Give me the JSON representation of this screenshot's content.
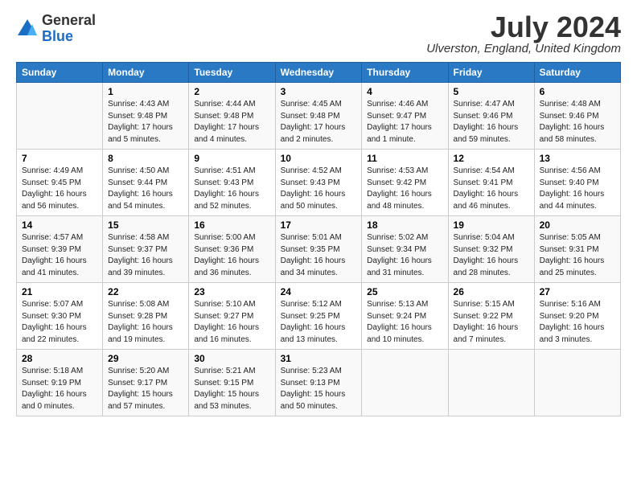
{
  "logo": {
    "general": "General",
    "blue": "Blue"
  },
  "title": "July 2024",
  "location": "Ulverston, England, United Kingdom",
  "days_of_week": [
    "Sunday",
    "Monday",
    "Tuesday",
    "Wednesday",
    "Thursday",
    "Friday",
    "Saturday"
  ],
  "weeks": [
    [
      {
        "day": "",
        "sunrise": "",
        "sunset": "",
        "daylight": ""
      },
      {
        "day": "1",
        "sunrise": "Sunrise: 4:43 AM",
        "sunset": "Sunset: 9:48 PM",
        "daylight": "Daylight: 17 hours and 5 minutes."
      },
      {
        "day": "2",
        "sunrise": "Sunrise: 4:44 AM",
        "sunset": "Sunset: 9:48 PM",
        "daylight": "Daylight: 17 hours and 4 minutes."
      },
      {
        "day": "3",
        "sunrise": "Sunrise: 4:45 AM",
        "sunset": "Sunset: 9:48 PM",
        "daylight": "Daylight: 17 hours and 2 minutes."
      },
      {
        "day": "4",
        "sunrise": "Sunrise: 4:46 AM",
        "sunset": "Sunset: 9:47 PM",
        "daylight": "Daylight: 17 hours and 1 minute."
      },
      {
        "day": "5",
        "sunrise": "Sunrise: 4:47 AM",
        "sunset": "Sunset: 9:46 PM",
        "daylight": "Daylight: 16 hours and 59 minutes."
      },
      {
        "day": "6",
        "sunrise": "Sunrise: 4:48 AM",
        "sunset": "Sunset: 9:46 PM",
        "daylight": "Daylight: 16 hours and 58 minutes."
      }
    ],
    [
      {
        "day": "7",
        "sunrise": "Sunrise: 4:49 AM",
        "sunset": "Sunset: 9:45 PM",
        "daylight": "Daylight: 16 hours and 56 minutes."
      },
      {
        "day": "8",
        "sunrise": "Sunrise: 4:50 AM",
        "sunset": "Sunset: 9:44 PM",
        "daylight": "Daylight: 16 hours and 54 minutes."
      },
      {
        "day": "9",
        "sunrise": "Sunrise: 4:51 AM",
        "sunset": "Sunset: 9:43 PM",
        "daylight": "Daylight: 16 hours and 52 minutes."
      },
      {
        "day": "10",
        "sunrise": "Sunrise: 4:52 AM",
        "sunset": "Sunset: 9:43 PM",
        "daylight": "Daylight: 16 hours and 50 minutes."
      },
      {
        "day": "11",
        "sunrise": "Sunrise: 4:53 AM",
        "sunset": "Sunset: 9:42 PM",
        "daylight": "Daylight: 16 hours and 48 minutes."
      },
      {
        "day": "12",
        "sunrise": "Sunrise: 4:54 AM",
        "sunset": "Sunset: 9:41 PM",
        "daylight": "Daylight: 16 hours and 46 minutes."
      },
      {
        "day": "13",
        "sunrise": "Sunrise: 4:56 AM",
        "sunset": "Sunset: 9:40 PM",
        "daylight": "Daylight: 16 hours and 44 minutes."
      }
    ],
    [
      {
        "day": "14",
        "sunrise": "Sunrise: 4:57 AM",
        "sunset": "Sunset: 9:39 PM",
        "daylight": "Daylight: 16 hours and 41 minutes."
      },
      {
        "day": "15",
        "sunrise": "Sunrise: 4:58 AM",
        "sunset": "Sunset: 9:37 PM",
        "daylight": "Daylight: 16 hours and 39 minutes."
      },
      {
        "day": "16",
        "sunrise": "Sunrise: 5:00 AM",
        "sunset": "Sunset: 9:36 PM",
        "daylight": "Daylight: 16 hours and 36 minutes."
      },
      {
        "day": "17",
        "sunrise": "Sunrise: 5:01 AM",
        "sunset": "Sunset: 9:35 PM",
        "daylight": "Daylight: 16 hours and 34 minutes."
      },
      {
        "day": "18",
        "sunrise": "Sunrise: 5:02 AM",
        "sunset": "Sunset: 9:34 PM",
        "daylight": "Daylight: 16 hours and 31 minutes."
      },
      {
        "day": "19",
        "sunrise": "Sunrise: 5:04 AM",
        "sunset": "Sunset: 9:32 PM",
        "daylight": "Daylight: 16 hours and 28 minutes."
      },
      {
        "day": "20",
        "sunrise": "Sunrise: 5:05 AM",
        "sunset": "Sunset: 9:31 PM",
        "daylight": "Daylight: 16 hours and 25 minutes."
      }
    ],
    [
      {
        "day": "21",
        "sunrise": "Sunrise: 5:07 AM",
        "sunset": "Sunset: 9:30 PM",
        "daylight": "Daylight: 16 hours and 22 minutes."
      },
      {
        "day": "22",
        "sunrise": "Sunrise: 5:08 AM",
        "sunset": "Sunset: 9:28 PM",
        "daylight": "Daylight: 16 hours and 19 minutes."
      },
      {
        "day": "23",
        "sunrise": "Sunrise: 5:10 AM",
        "sunset": "Sunset: 9:27 PM",
        "daylight": "Daylight: 16 hours and 16 minutes."
      },
      {
        "day": "24",
        "sunrise": "Sunrise: 5:12 AM",
        "sunset": "Sunset: 9:25 PM",
        "daylight": "Daylight: 16 hours and 13 minutes."
      },
      {
        "day": "25",
        "sunrise": "Sunrise: 5:13 AM",
        "sunset": "Sunset: 9:24 PM",
        "daylight": "Daylight: 16 hours and 10 minutes."
      },
      {
        "day": "26",
        "sunrise": "Sunrise: 5:15 AM",
        "sunset": "Sunset: 9:22 PM",
        "daylight": "Daylight: 16 hours and 7 minutes."
      },
      {
        "day": "27",
        "sunrise": "Sunrise: 5:16 AM",
        "sunset": "Sunset: 9:20 PM",
        "daylight": "Daylight: 16 hours and 3 minutes."
      }
    ],
    [
      {
        "day": "28",
        "sunrise": "Sunrise: 5:18 AM",
        "sunset": "Sunset: 9:19 PM",
        "daylight": "Daylight: 16 hours and 0 minutes."
      },
      {
        "day": "29",
        "sunrise": "Sunrise: 5:20 AM",
        "sunset": "Sunset: 9:17 PM",
        "daylight": "Daylight: 15 hours and 57 minutes."
      },
      {
        "day": "30",
        "sunrise": "Sunrise: 5:21 AM",
        "sunset": "Sunset: 9:15 PM",
        "daylight": "Daylight: 15 hours and 53 minutes."
      },
      {
        "day": "31",
        "sunrise": "Sunrise: 5:23 AM",
        "sunset": "Sunset: 9:13 PM",
        "daylight": "Daylight: 15 hours and 50 minutes."
      },
      {
        "day": "",
        "sunrise": "",
        "sunset": "",
        "daylight": ""
      },
      {
        "day": "",
        "sunrise": "",
        "sunset": "",
        "daylight": ""
      },
      {
        "day": "",
        "sunrise": "",
        "sunset": "",
        "daylight": ""
      }
    ]
  ]
}
